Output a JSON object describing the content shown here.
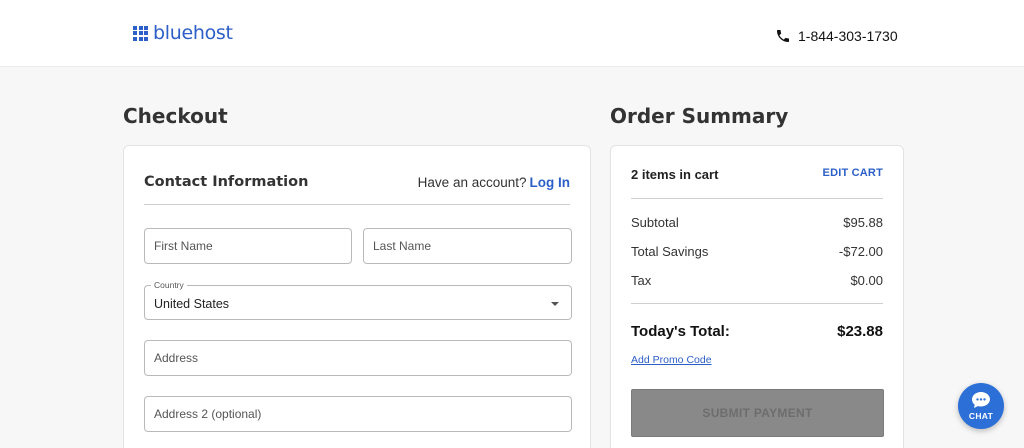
{
  "header": {
    "logo_text": "bluehost",
    "phone": "1-844-303-1730"
  },
  "checkout": {
    "title": "Checkout",
    "contact": {
      "title": "Contact Information",
      "account_prompt": "Have an account?",
      "login_label": "Log In",
      "first_name_placeholder": "First Name",
      "last_name_placeholder": "Last Name",
      "country_label": "Country",
      "country_value": "United States",
      "address_placeholder": "Address",
      "address2_placeholder": "Address 2 (optional)"
    }
  },
  "summary": {
    "title": "Order Summary",
    "items_in_cart": "2 items in cart",
    "edit_cart": "EDIT CART",
    "rows": [
      {
        "label": "Subtotal",
        "value": "$95.88"
      },
      {
        "label": "Total Savings",
        "value": "-$72.00"
      },
      {
        "label": "Tax",
        "value": "$0.00"
      }
    ],
    "total_label": "Today's Total:",
    "total_value": "$23.88",
    "promo_label": "Add Promo Code",
    "submit_label": "SUBMIT PAYMENT"
  },
  "chat": {
    "label": "CHAT"
  },
  "colors": {
    "brand": "#2c5fc7",
    "chat": "#2c6fd6",
    "submit_disabled": "#898989"
  },
  "icons": [
    "bluehost-logo-grid-icon",
    "phone-icon",
    "chevron-down-icon",
    "chat-bubble-icon"
  ]
}
